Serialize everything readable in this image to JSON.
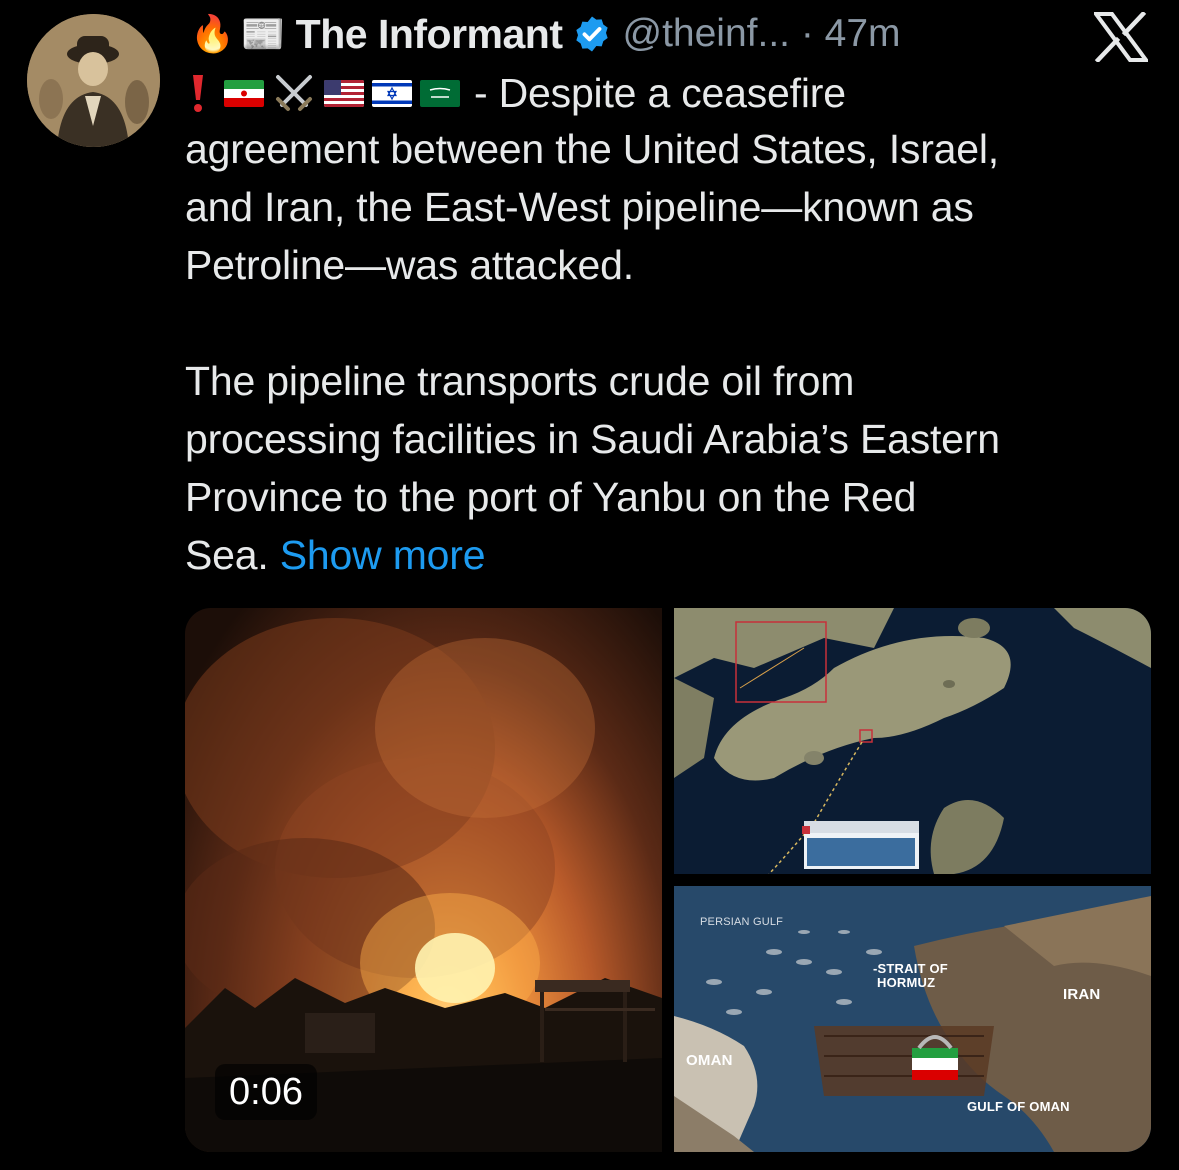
{
  "tweet": {
    "author_name": "The Informant",
    "handle_time": "@theinf... · 47m",
    "lead_emojis": [
      "🔥",
      "📰"
    ],
    "line1_text": "- Despite a ceasefire",
    "body_line2": "agreement between the United States, Israel,",
    "body_line3": "and Iran, the East-West pipeline—known as",
    "body_line4": "Petroline—was attacked.",
    "para2_line1": "The pipeline transports crude oil from",
    "para2_line2": "processing facilities in Saudi Arabia’s Eastern",
    "para2_line3": "Province to the port of Yanbu on the Red",
    "para2_line4": "Sea.",
    "show_more": "Show more"
  },
  "media": {
    "video_duration": "0:06",
    "map2_labels": {
      "persian_gulf": "PERSIAN GULF",
      "strait": "-STRAIT OF",
      "hormuz": "HORMUZ",
      "iran": "IRAN",
      "oman": "OMAN",
      "gulf_of_oman": "GULF OF OMAN"
    }
  },
  "colors": {
    "background": "#000000",
    "text": "#e7e9ea",
    "secondary": "#8b98a5",
    "link": "#1d9bf0",
    "verified": "#1d9bf0"
  },
  "icons": [
    "x-logo-icon",
    "verified-badge-icon",
    "fire-icon",
    "newspaper-icon",
    "exclamation-icon",
    "crossed-swords-icon"
  ]
}
